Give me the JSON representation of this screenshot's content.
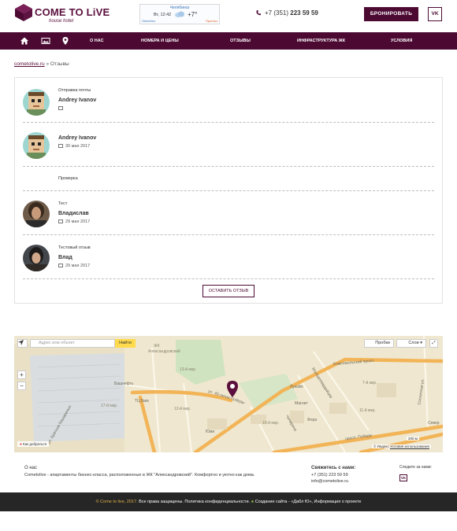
{
  "header": {
    "logo_text": "COME TO LiVE",
    "logo_sub": "house hotel",
    "weather": {
      "city": "Челябинск",
      "time": "Вт, 12:42",
      "temp": "+7°",
      "source": "Gismeteo",
      "more": "Прогноз"
    },
    "phone_prefix": "+7 (351)",
    "phone_number": "223 59 59",
    "book_label": "БРОНИРОВАТЬ",
    "vk_label": "VK"
  },
  "nav": {
    "items": [
      "О НАС",
      "НОМЕРА И ЦЕНЫ",
      "ОТЗЫВЫ",
      "ИНФРАСТРУКТУРА ЖК",
      "УСЛОВИЯ"
    ]
  },
  "breadcrumb": {
    "home": "cometolive.ru",
    "separator": "»",
    "current": "Отзывы"
  },
  "reviews": [
    {
      "subject": "Отправка почты",
      "author": "Andrey Ivanov",
      "date": ""
    },
    {
      "subject": "",
      "author": "Andrey Ivanov",
      "date": "30 мая 2017"
    },
    {
      "subject": "Проверка",
      "author": "",
      "date": ""
    },
    {
      "subject": "Тест",
      "author": "Владислав",
      "date": "29 мая 2017"
    },
    {
      "subject": "Тестовый отзыв",
      "author": "Влад",
      "date": "29 мая 2017"
    }
  ],
  "leave_review_label": "ОСТАВИТЬ ОТЗЫВ",
  "map": {
    "search_placeholder": "Адрес или объект",
    "search_button": "Найти",
    "traffic_label": "Пробки",
    "layers_label": "Слои",
    "route_label": "Как добраться",
    "copyright": "© Яндекс",
    "terms": "Условия использования",
    "scale": "200 м",
    "labels": {
      "district1": "ЖК",
      "district2": "Александровский",
      "mkr13": "13-й мкр.",
      "mkr7": "7-й мкр.",
      "mkr17": "17-й мкр.",
      "mkr12": "12-й мкр.",
      "mkr10": "10-й мкр.",
      "mkr11": "11-й мкр.",
      "bashneft": "Башнефть",
      "tts": "ТЦ Бим",
      "lukoil": "Лукойл",
      "magnit": "Магнит",
      "fora": "Фора",
      "yumi": "Юми",
      "sever": "Север",
      "komsomol": "Комсомольский просп.",
      "pobedy": "просп. Победы",
      "let40": "ул. 40-летия Победы",
      "molodogvardeytsev": "Молодогвардейцев",
      "chicherina": "Чичерина",
      "solnechnaya": "Солнечная ул.",
      "bratyev": "ул. Братьев Кашириных"
    }
  },
  "footer": {
    "about_title": "О нас",
    "about_text": "Cometolive - апартаменты бизнес-класса, расположенные в ЖК \"Александровский\". Комфортно и уютно как дома.",
    "contact_title": "Свяжитесь с нами:",
    "contact_phone": "+7 (351) 223 59 59",
    "contact_email": "info@cometolive.ru",
    "follow_label": "Следите за нами:",
    "vk_label": "VK",
    "copyright_year": "© Come to live, 2017.",
    "copyright_rest": "Все права защищены. Политика конфиденциальности.",
    "copyright_dev": "Создание сайта - «Дабл Ю», Информация о проекте"
  },
  "colors": {
    "brand": "#4c0a33",
    "map_bg": "#efe7cf",
    "road_major": "#f2b457",
    "park": "#cfe3c0",
    "pin": "#5a0f3c"
  }
}
